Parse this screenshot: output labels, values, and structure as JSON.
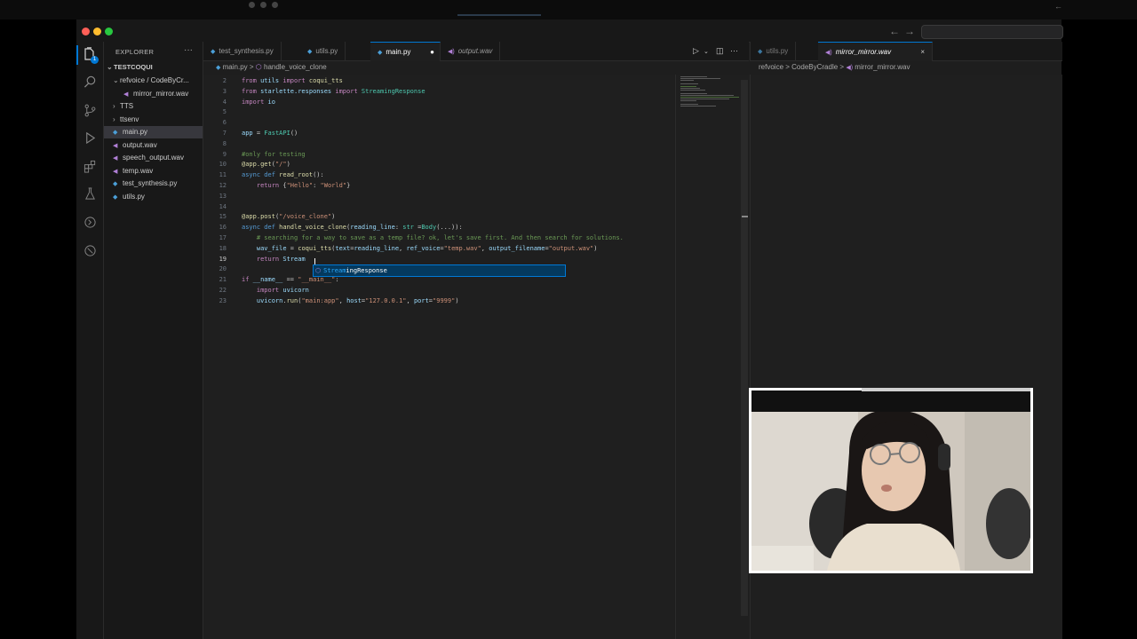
{
  "colors": {
    "accent": "#0078d4",
    "keyword": "#c586c0",
    "function": "#dcdcaa",
    "string": "#ce9178",
    "comment": "#6a9955",
    "type": "#4ec9b0"
  },
  "explorer": {
    "title": "EXPLORER",
    "more": "···",
    "root": "TESTCOQUI",
    "items": [
      {
        "label": "refvoice / CodeByCr...",
        "kind": "folder-open",
        "indent": 1
      },
      {
        "label": "mirror_mirror.wav",
        "kind": "wav",
        "indent": 2
      },
      {
        "label": "TTS",
        "kind": "folder",
        "indent": 1
      },
      {
        "label": "ttsenv",
        "kind": "folder",
        "indent": 1
      },
      {
        "label": "main.py",
        "kind": "py",
        "indent": 1,
        "selected": true
      },
      {
        "label": "output.wav",
        "kind": "wav",
        "indent": 1
      },
      {
        "label": "speech_output.wav",
        "kind": "wav",
        "indent": 1
      },
      {
        "label": "temp.wav",
        "kind": "wav",
        "indent": 1
      },
      {
        "label": "test_synthesis.py",
        "kind": "py",
        "indent": 1
      },
      {
        "label": "utils.py",
        "kind": "py",
        "indent": 1
      }
    ]
  },
  "activity": {
    "badge": "1"
  },
  "tabs_left": [
    {
      "label": "test_synthesis.py",
      "kind": "py"
    },
    {
      "label": "utils.py",
      "kind": "py"
    },
    {
      "label": "main.py",
      "kind": "py",
      "active": true,
      "dirty": "●"
    },
    {
      "label": "output.wav",
      "kind": "wav",
      "italic": true
    }
  ],
  "breadcrumb_left": {
    "file": "main.py",
    "sep": ">",
    "symbol": "handle_voice_clone"
  },
  "tabs_right": [
    {
      "label": "utils.py",
      "kind": "py"
    },
    {
      "label": "mirror_mirror.wav",
      "kind": "wav",
      "italic": true,
      "active": true,
      "close": "×"
    }
  ],
  "breadcrumb_right": {
    "a": "refvoice",
    "b": "CodeByCradle",
    "c": "mirror_mirror.wav",
    "sep": ">"
  },
  "code": {
    "line_numbers": [
      "2",
      "3",
      "4",
      "5",
      "6",
      "7",
      "8",
      "9",
      "10",
      "11",
      "12",
      "13",
      "14",
      "15",
      "16",
      "17",
      "18",
      "19",
      "20",
      "21",
      "22",
      "23"
    ],
    "current_line": "19",
    "lines": [
      [
        [
          "kw",
          "from "
        ],
        [
          "va",
          "utils "
        ],
        [
          "kw",
          "import "
        ],
        [
          "fn",
          "coqui_tts"
        ]
      ],
      [
        [
          "kw",
          "from "
        ],
        [
          "va",
          "starlette.responses "
        ],
        [
          "kw",
          "import "
        ],
        [
          "ty",
          "StreamingResponse"
        ]
      ],
      [
        [
          "kw",
          "import "
        ],
        [
          "va",
          "io"
        ]
      ],
      [],
      [],
      [
        [
          "va",
          "app "
        ],
        [
          "",
          "= "
        ],
        [
          "ty",
          "FastAPI"
        ],
        [
          "",
          "()"
        ]
      ],
      [],
      [
        [
          "cm",
          "#only for testing"
        ]
      ],
      [
        [
          "fn",
          "@app.get"
        ],
        [
          "",
          "("
        ],
        [
          "st",
          "\"/\""
        ],
        [
          "",
          ")"
        ]
      ],
      [
        [
          "k2",
          "async def "
        ],
        [
          "fn",
          "read_root"
        ],
        [
          "",
          "():"
        ]
      ],
      [
        [
          "",
          "    "
        ],
        [
          "kw",
          "return "
        ],
        [
          "",
          "{"
        ],
        [
          "st",
          "\"Hello\""
        ],
        [
          "",
          ": "
        ],
        [
          "st",
          "\"World\""
        ],
        [
          "",
          "}"
        ]
      ],
      [],
      [],
      [
        [
          "fn",
          "@app.post"
        ],
        [
          "",
          "("
        ],
        [
          "st",
          "\"/voice_clone\""
        ],
        [
          "",
          ")"
        ]
      ],
      [
        [
          "k2",
          "async def "
        ],
        [
          "fn",
          "handle_voice_clone"
        ],
        [
          "",
          "("
        ],
        [
          "va",
          "reading_line"
        ],
        [
          "",
          ": "
        ],
        [
          "ty",
          "str "
        ],
        [
          "",
          "="
        ],
        [
          "ty",
          "Body"
        ],
        [
          "",
          "(...)):"
        ]
      ],
      [
        [
          "",
          "    "
        ],
        [
          "cm",
          "# searching for a way to save as a temp file? ok, let's save first. And then search for solutions."
        ]
      ],
      [
        [
          "",
          "    "
        ],
        [
          "va",
          "wav_file "
        ],
        [
          "",
          "= "
        ],
        [
          "fn",
          "coqui_tts"
        ],
        [
          "",
          "("
        ],
        [
          "va",
          "text"
        ],
        [
          "",
          "="
        ],
        [
          "va",
          "reading_line"
        ],
        [
          "",
          ", "
        ],
        [
          "va",
          "ref_voice"
        ],
        [
          "",
          "="
        ],
        [
          "st",
          "\"temp.wav\""
        ],
        [
          "",
          ", "
        ],
        [
          "va",
          "output_filename"
        ],
        [
          "",
          "="
        ],
        [
          "st",
          "\"output.wav\""
        ],
        [
          "",
          ")"
        ]
      ],
      [
        [
          "",
          "    "
        ],
        [
          "kw",
          "return "
        ],
        [
          "va",
          "Stream"
        ]
      ],
      [],
      [
        [
          "kw",
          "if "
        ],
        [
          "va",
          "__name__ "
        ],
        [
          "",
          "== "
        ],
        [
          "st",
          "\"__main__\""
        ],
        [
          "",
          ":"
        ]
      ],
      [
        [
          "",
          "    "
        ],
        [
          "kw",
          "import "
        ],
        [
          "va",
          "uvicorn"
        ]
      ],
      [
        [
          "",
          "    "
        ],
        [
          "va",
          "uvicorn"
        ],
        [
          "",
          "."
        ],
        [
          "fn",
          "run"
        ],
        [
          "",
          "("
        ],
        [
          "st",
          "\"main:app\""
        ],
        [
          "",
          ", "
        ],
        [
          "va",
          "host"
        ],
        [
          "",
          "="
        ],
        [
          "st",
          "\"127.0.0.1\""
        ],
        [
          "",
          ", "
        ],
        [
          "va",
          "port"
        ],
        [
          "",
          "="
        ],
        [
          "st",
          "\"9999\""
        ],
        [
          "",
          ")"
        ]
      ]
    ]
  },
  "suggestion": {
    "match": "Stream",
    "rest": "ingResponse"
  },
  "webcam": {
    "description_alt": "presenter webcam"
  }
}
